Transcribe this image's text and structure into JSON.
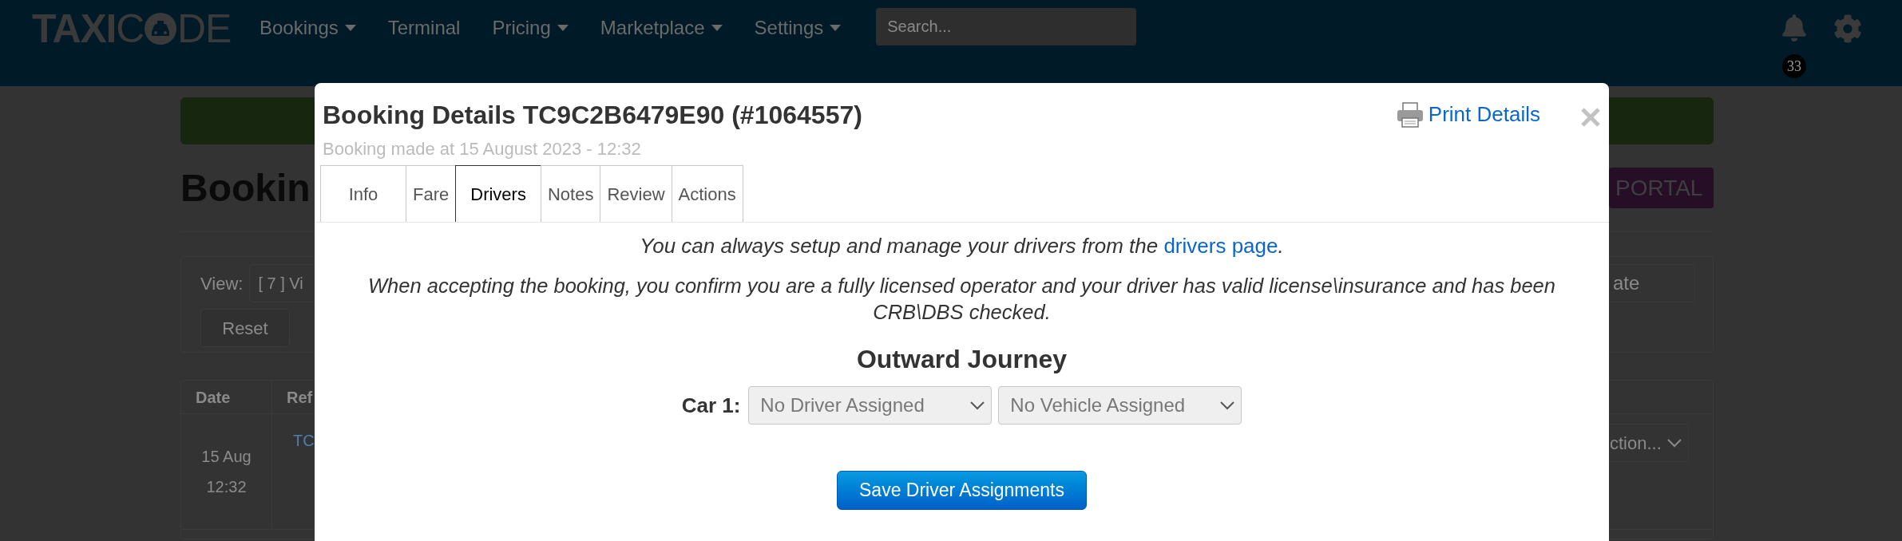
{
  "navbar": {
    "logo": {
      "bold": "TAXI",
      "light_start": "C",
      "light_end": "DE"
    },
    "items": [
      {
        "label": "Bookings",
        "dropdown": true
      },
      {
        "label": "Terminal",
        "dropdown": false
      },
      {
        "label": "Pricing",
        "dropdown": true
      },
      {
        "label": "Marketplace",
        "dropdown": true
      },
      {
        "label": "Settings",
        "dropdown": true
      }
    ],
    "search": {
      "placeholder": "Search..."
    },
    "notifications": {
      "count": "33"
    }
  },
  "page": {
    "heading": "Bookin",
    "portal_button": "PORTAL",
    "filters": {
      "view_label": "View:",
      "view_value": "[ 7 ] Vi",
      "reset_button": "Reset",
      "date_field": "ate"
    },
    "table": {
      "columns": [
        "Date",
        "Ref"
      ],
      "rows": [
        {
          "date": "15 Aug",
          "time": "12:32",
          "ref": "TC",
          "action": "ction..."
        }
      ]
    }
  },
  "modal": {
    "title": "Booking Details TC9C2B6479E90 (#1064557)",
    "print_link": "Print Details",
    "subtitle": "Booking made at 15 August 2023 - 12:32",
    "tabs": [
      {
        "label": "Info",
        "selected": false
      },
      {
        "label": "Fare",
        "selected": false
      },
      {
        "label": "Drivers",
        "selected": true
      },
      {
        "label": "Notes",
        "selected": false
      },
      {
        "label": "Review",
        "selected": false
      },
      {
        "label": "Actions",
        "selected": false
      }
    ],
    "notice": {
      "before": "You can always setup and manage your drivers from the ",
      "link": "drivers page",
      "after": "."
    },
    "confirmation": "When accepting the booking, you confirm you are a fully licensed operator and your driver has valid license\\insurance and has been CRB\\DBS checked.",
    "journey": {
      "title": "Outward Journey",
      "cars": [
        {
          "label": "Car 1:",
          "driver": "No Driver Assigned",
          "vehicle": "No Vehicle Assigned"
        }
      ]
    },
    "save_button": "Save Driver Assignments"
  }
}
